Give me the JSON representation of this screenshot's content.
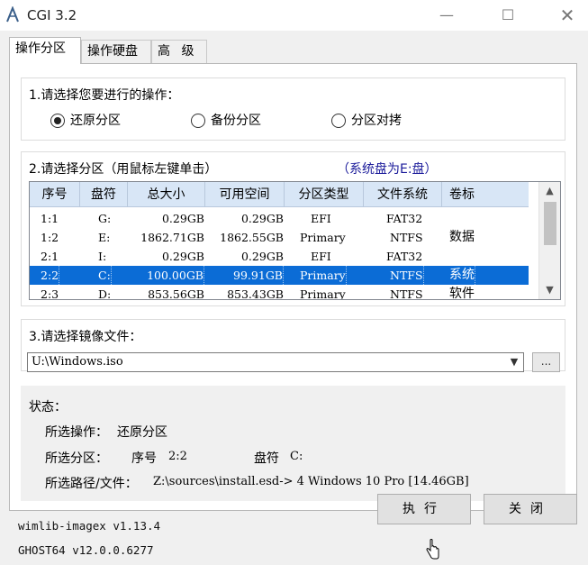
{
  "window": {
    "title": "CGI 3.2",
    "controls": {
      "minimize": "—",
      "maximize": "☐",
      "close": "✕"
    }
  },
  "tabs": [
    {
      "label": "操作分区",
      "active": true
    },
    {
      "label": "操作硬盘",
      "active": false
    },
    {
      "label": "高 级",
      "active": false
    }
  ],
  "operation": {
    "heading": "1.请选择您要进行的操作：",
    "options": [
      {
        "label": "还原分区",
        "checked": true
      },
      {
        "label": "备份分区",
        "checked": false
      },
      {
        "label": "分区对拷",
        "checked": false
      }
    ]
  },
  "partition": {
    "heading": "2.请选择分区（用鼠标左键单击）",
    "system_note": "（系统盘为E:盘）",
    "columns": [
      "序号",
      "盘符",
      "总大小",
      "可用空间",
      "分区类型",
      "文件系统",
      "卷标"
    ],
    "rows": [
      {
        "num": "1:1",
        "drive": "G:",
        "total": "0.29GB",
        "free": "0.29GB",
        "type": "EFI",
        "fs": "FAT32",
        "label": "",
        "selected": false
      },
      {
        "num": "1:2",
        "drive": "E:",
        "total": "1862.71GB",
        "free": "1862.55GB",
        "type": "Primary",
        "fs": "NTFS",
        "label": "数据",
        "selected": false
      },
      {
        "num": "2:1",
        "drive": "I:",
        "total": "0.29GB",
        "free": "0.29GB",
        "type": "EFI",
        "fs": "FAT32",
        "label": "",
        "selected": false
      },
      {
        "num": "2:2",
        "drive": "C:",
        "total": "100.00GB",
        "free": "99.91GB",
        "type": "Primary",
        "fs": "NTFS",
        "label": "系统",
        "selected": true
      },
      {
        "num": "2:3",
        "drive": "D:",
        "total": "853.56GB",
        "free": "853.43GB",
        "type": "Primary",
        "fs": "NTFS",
        "label": "软件",
        "selected": false
      }
    ],
    "scroll": {
      "up": "▲",
      "down": "▼"
    }
  },
  "image": {
    "heading": "3.请选择镜像文件：",
    "value": "U:\\Windows.iso",
    "dropdown_arrow": "▼",
    "browse_label": "..."
  },
  "status": {
    "heading": "状态：",
    "operation_label": "所选操作：",
    "operation_value": "还原分区",
    "partition_label": "所选分区：",
    "partition_num_label": "序号",
    "partition_num_value": "2:2",
    "drive_label": "盘符",
    "drive_value": "C:",
    "path_label": "所选路径/文件：",
    "path_value": "Z:\\sources\\install.esd-> 4  Windows 10 Pro [14.46GB]"
  },
  "footer": {
    "version_line1": "wimlib-imagex v1.13.4",
    "version_line2": "GHOST64 v12.0.0.6277",
    "execute_label": "执行",
    "close_label": "关闭"
  },
  "colors": {
    "selection": "#0b6cd6",
    "header_bg": "#d8e6f6",
    "accent_text": "#1a1a9a",
    "window_bg": "#f0f0f0"
  }
}
